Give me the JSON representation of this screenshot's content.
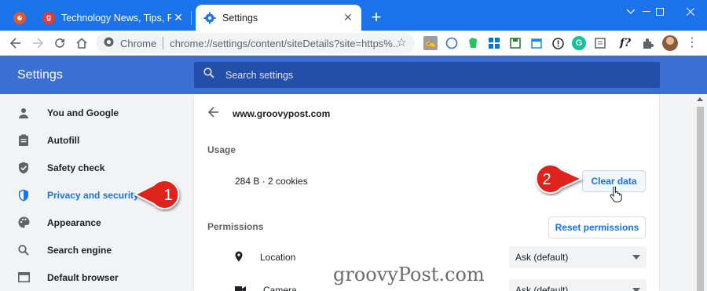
{
  "browser": {
    "tabs": [
      {
        "title": "",
        "favicon_color": "#de5833",
        "favicon": "duckduckgo-icon",
        "pinned": true
      },
      {
        "title": "Technology News, Tips, Reviews,",
        "favicon_color": "#e53935",
        "favicon_letter": "g"
      },
      {
        "title": "Settings",
        "favicon": "gear-icon",
        "active": true
      }
    ],
    "omnibox": {
      "chip": "Chrome",
      "url": "chrome://settings/content/siteDetails?site=https%..."
    },
    "accent": "#1a73e8"
  },
  "settings": {
    "title": "Settings",
    "search_placeholder": "Search settings",
    "header_color": "#3b6fd1"
  },
  "sidebar": {
    "items": [
      {
        "label": "You and Google",
        "icon": "person-icon"
      },
      {
        "label": "Autofill",
        "icon": "clipboard-icon"
      },
      {
        "label": "Safety check",
        "icon": "shield-check-icon"
      },
      {
        "label": "Privacy and security",
        "icon": "shield-icon",
        "active": true
      },
      {
        "label": "Appearance",
        "icon": "palette-icon"
      },
      {
        "label": "Search engine",
        "icon": "search-icon"
      },
      {
        "label": "Default browser",
        "icon": "browser-icon"
      }
    ]
  },
  "site_details": {
    "site": "www.groovypost.com",
    "usage_label": "Usage",
    "usage_value": "284 B · 2 cookies",
    "clear_button": "Clear data",
    "permissions_label": "Permissions",
    "reset_button": "Reset permissions",
    "permissions": [
      {
        "label": "Location",
        "icon": "location-icon",
        "value": "Ask (default)"
      },
      {
        "label": "Camera",
        "icon": "camera-icon",
        "value": "Ask (default)"
      }
    ]
  },
  "callouts": {
    "one": "1",
    "two": "2",
    "color": "#e0241b"
  },
  "watermark": "groovyPost.com"
}
